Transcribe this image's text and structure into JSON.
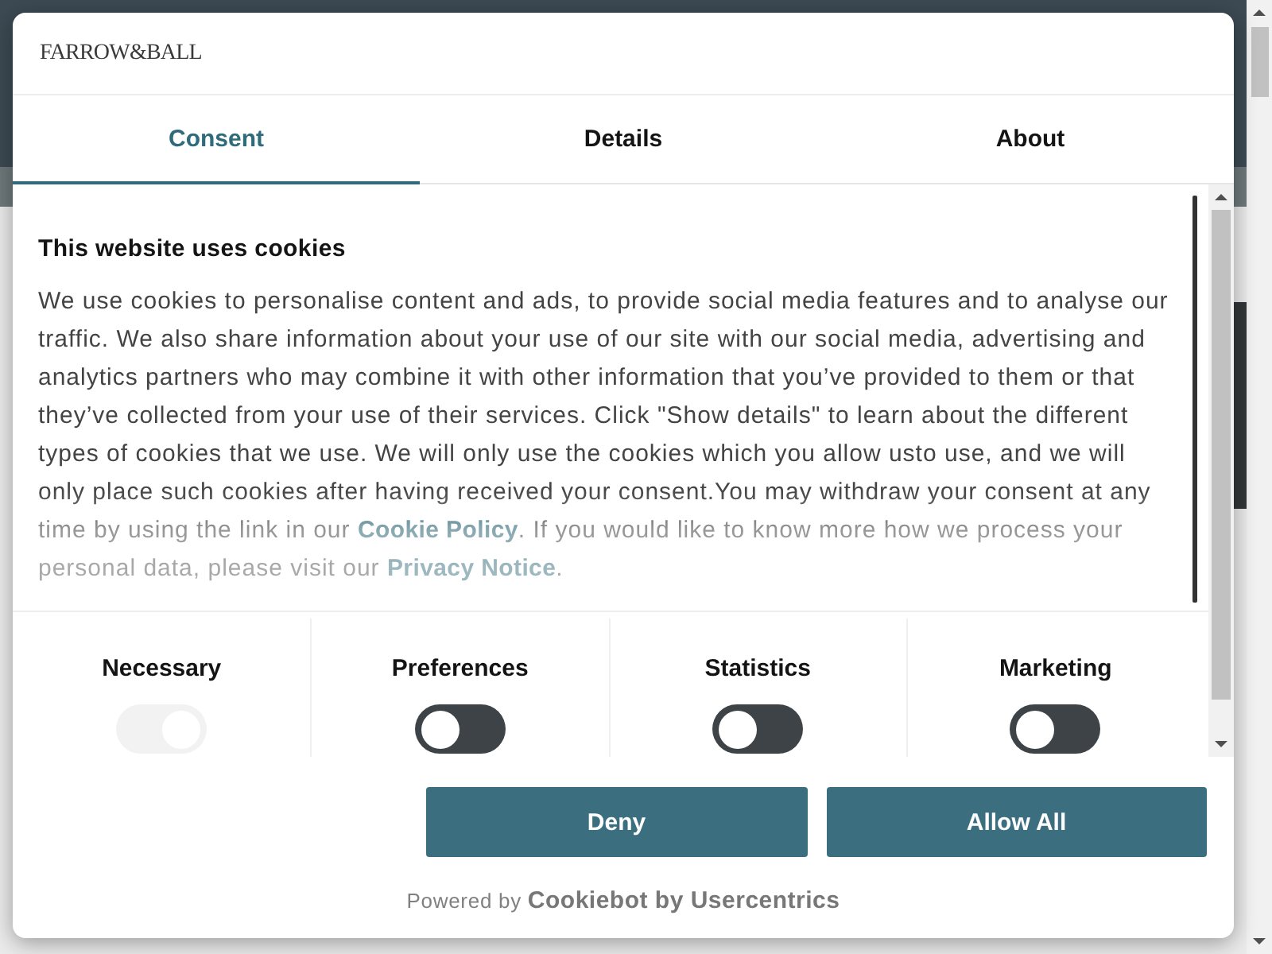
{
  "logo": "FARROW&BALL",
  "tabs": [
    {
      "label": "Consent",
      "selected": true
    },
    {
      "label": "Details",
      "selected": false
    },
    {
      "label": "About",
      "selected": false
    }
  ],
  "consent": {
    "heading": "This website uses cookies",
    "text": [
      {
        "kind": "text",
        "text": "We use cookies to personalise content and ads, to provide social media features and to analyse our traffic. We also share information about your use of our site with our social media, advertising and analytics partners who may combine it with other information that you’ve provided to them or that they’ve collected from your use of their services. Click \"Show details\" to learn about the different types of cookies that we use. We will only use the cookies which you allow usto use, and we will only place such cookies after having received your consent.You may withdraw your consent at any time by using the link in our "
      },
      {
        "kind": "link",
        "text": "Cookie Policy"
      },
      {
        "kind": "text",
        "text": ". If you would like to know more how we process your personal data, please visit our "
      },
      {
        "kind": "link",
        "text": "Privacy Notice"
      },
      {
        "kind": "text",
        "text": "."
      }
    ]
  },
  "categories": [
    {
      "label": "Necessary",
      "checked": true,
      "disabled": true
    },
    {
      "label": "Preferences",
      "checked": false,
      "disabled": false
    },
    {
      "label": "Statistics",
      "checked": false,
      "disabled": false
    },
    {
      "label": "Marketing",
      "checked": false,
      "disabled": false
    }
  ],
  "buttons": [
    "Deny",
    "Allow All"
  ],
  "footer": {
    "prefix": "Powered by",
    "brand": "Cookiebot by Usercentrics"
  }
}
